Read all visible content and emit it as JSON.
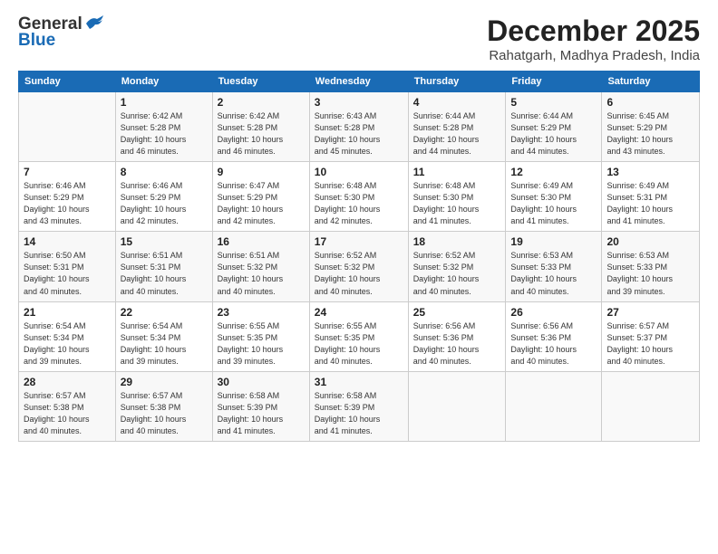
{
  "header": {
    "logo_general": "General",
    "logo_blue": "Blue",
    "month_title": "December 2025",
    "location": "Rahatgarh, Madhya Pradesh, India"
  },
  "weekdays": [
    "Sunday",
    "Monday",
    "Tuesday",
    "Wednesday",
    "Thursday",
    "Friday",
    "Saturday"
  ],
  "weeks": [
    [
      {
        "day": "",
        "info": ""
      },
      {
        "day": "1",
        "info": "Sunrise: 6:42 AM\nSunset: 5:28 PM\nDaylight: 10 hours\nand 46 minutes."
      },
      {
        "day": "2",
        "info": "Sunrise: 6:42 AM\nSunset: 5:28 PM\nDaylight: 10 hours\nand 46 minutes."
      },
      {
        "day": "3",
        "info": "Sunrise: 6:43 AM\nSunset: 5:28 PM\nDaylight: 10 hours\nand 45 minutes."
      },
      {
        "day": "4",
        "info": "Sunrise: 6:44 AM\nSunset: 5:28 PM\nDaylight: 10 hours\nand 44 minutes."
      },
      {
        "day": "5",
        "info": "Sunrise: 6:44 AM\nSunset: 5:29 PM\nDaylight: 10 hours\nand 44 minutes."
      },
      {
        "day": "6",
        "info": "Sunrise: 6:45 AM\nSunset: 5:29 PM\nDaylight: 10 hours\nand 43 minutes."
      }
    ],
    [
      {
        "day": "7",
        "info": "Sunrise: 6:46 AM\nSunset: 5:29 PM\nDaylight: 10 hours\nand 43 minutes."
      },
      {
        "day": "8",
        "info": "Sunrise: 6:46 AM\nSunset: 5:29 PM\nDaylight: 10 hours\nand 42 minutes."
      },
      {
        "day": "9",
        "info": "Sunrise: 6:47 AM\nSunset: 5:29 PM\nDaylight: 10 hours\nand 42 minutes."
      },
      {
        "day": "10",
        "info": "Sunrise: 6:48 AM\nSunset: 5:30 PM\nDaylight: 10 hours\nand 42 minutes."
      },
      {
        "day": "11",
        "info": "Sunrise: 6:48 AM\nSunset: 5:30 PM\nDaylight: 10 hours\nand 41 minutes."
      },
      {
        "day": "12",
        "info": "Sunrise: 6:49 AM\nSunset: 5:30 PM\nDaylight: 10 hours\nand 41 minutes."
      },
      {
        "day": "13",
        "info": "Sunrise: 6:49 AM\nSunset: 5:31 PM\nDaylight: 10 hours\nand 41 minutes."
      }
    ],
    [
      {
        "day": "14",
        "info": "Sunrise: 6:50 AM\nSunset: 5:31 PM\nDaylight: 10 hours\nand 40 minutes."
      },
      {
        "day": "15",
        "info": "Sunrise: 6:51 AM\nSunset: 5:31 PM\nDaylight: 10 hours\nand 40 minutes."
      },
      {
        "day": "16",
        "info": "Sunrise: 6:51 AM\nSunset: 5:32 PM\nDaylight: 10 hours\nand 40 minutes."
      },
      {
        "day": "17",
        "info": "Sunrise: 6:52 AM\nSunset: 5:32 PM\nDaylight: 10 hours\nand 40 minutes."
      },
      {
        "day": "18",
        "info": "Sunrise: 6:52 AM\nSunset: 5:32 PM\nDaylight: 10 hours\nand 40 minutes."
      },
      {
        "day": "19",
        "info": "Sunrise: 6:53 AM\nSunset: 5:33 PM\nDaylight: 10 hours\nand 40 minutes."
      },
      {
        "day": "20",
        "info": "Sunrise: 6:53 AM\nSunset: 5:33 PM\nDaylight: 10 hours\nand 39 minutes."
      }
    ],
    [
      {
        "day": "21",
        "info": "Sunrise: 6:54 AM\nSunset: 5:34 PM\nDaylight: 10 hours\nand 39 minutes."
      },
      {
        "day": "22",
        "info": "Sunrise: 6:54 AM\nSunset: 5:34 PM\nDaylight: 10 hours\nand 39 minutes."
      },
      {
        "day": "23",
        "info": "Sunrise: 6:55 AM\nSunset: 5:35 PM\nDaylight: 10 hours\nand 39 minutes."
      },
      {
        "day": "24",
        "info": "Sunrise: 6:55 AM\nSunset: 5:35 PM\nDaylight: 10 hours\nand 40 minutes."
      },
      {
        "day": "25",
        "info": "Sunrise: 6:56 AM\nSunset: 5:36 PM\nDaylight: 10 hours\nand 40 minutes."
      },
      {
        "day": "26",
        "info": "Sunrise: 6:56 AM\nSunset: 5:36 PM\nDaylight: 10 hours\nand 40 minutes."
      },
      {
        "day": "27",
        "info": "Sunrise: 6:57 AM\nSunset: 5:37 PM\nDaylight: 10 hours\nand 40 minutes."
      }
    ],
    [
      {
        "day": "28",
        "info": "Sunrise: 6:57 AM\nSunset: 5:38 PM\nDaylight: 10 hours\nand 40 minutes."
      },
      {
        "day": "29",
        "info": "Sunrise: 6:57 AM\nSunset: 5:38 PM\nDaylight: 10 hours\nand 40 minutes."
      },
      {
        "day": "30",
        "info": "Sunrise: 6:58 AM\nSunset: 5:39 PM\nDaylight: 10 hours\nand 41 minutes."
      },
      {
        "day": "31",
        "info": "Sunrise: 6:58 AM\nSunset: 5:39 PM\nDaylight: 10 hours\nand 41 minutes."
      },
      {
        "day": "",
        "info": ""
      },
      {
        "day": "",
        "info": ""
      },
      {
        "day": "",
        "info": ""
      }
    ]
  ]
}
